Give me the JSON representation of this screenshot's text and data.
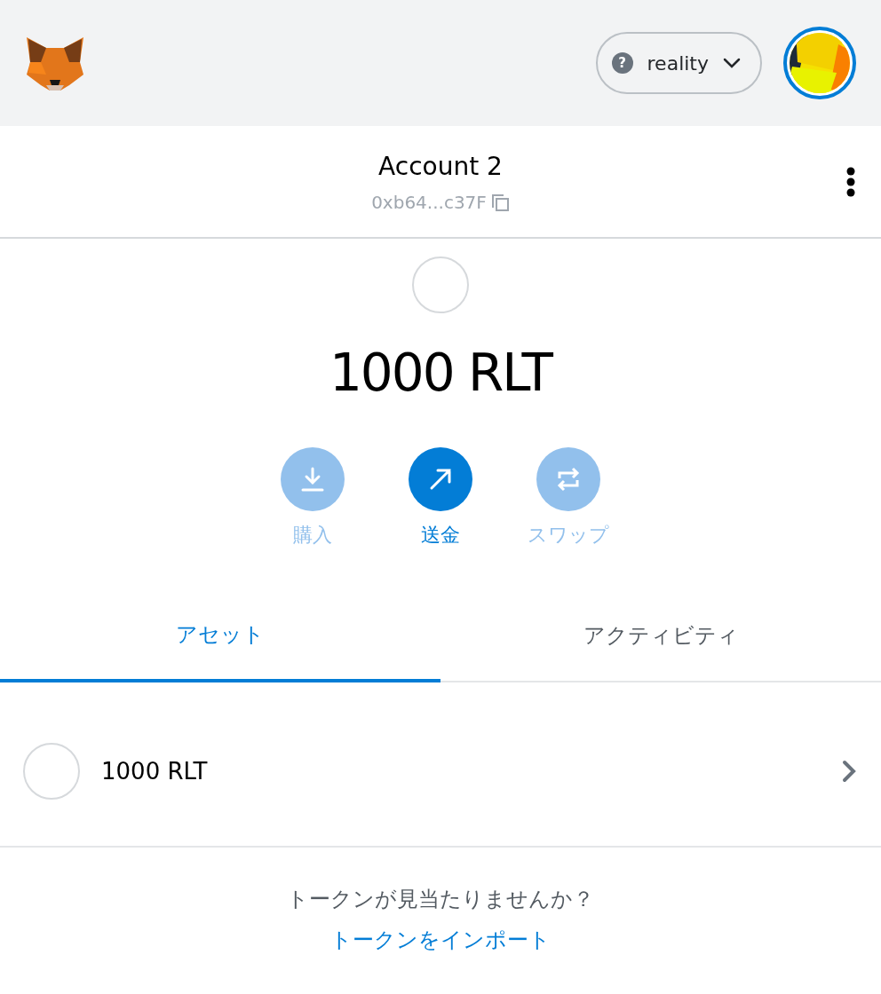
{
  "network": {
    "icon": "?",
    "label": "reality"
  },
  "account": {
    "name": "Account 2",
    "address": "0xb64...c37F"
  },
  "balance": "1000 RLT",
  "actions": [
    {
      "kind": "download",
      "label": "購入",
      "disabled": true
    },
    {
      "kind": "send",
      "label": "送金",
      "disabled": false
    },
    {
      "kind": "swap",
      "label": "スワップ",
      "disabled": true
    }
  ],
  "tabs": [
    {
      "label": "アセット",
      "selected": true
    },
    {
      "label": "アクティビティ",
      "selected": false
    }
  ],
  "assets": [
    {
      "label": "1000 RLT"
    }
  ],
  "footer": {
    "question": "トークンが見当たりませんか？",
    "link": "トークンをインポート"
  }
}
